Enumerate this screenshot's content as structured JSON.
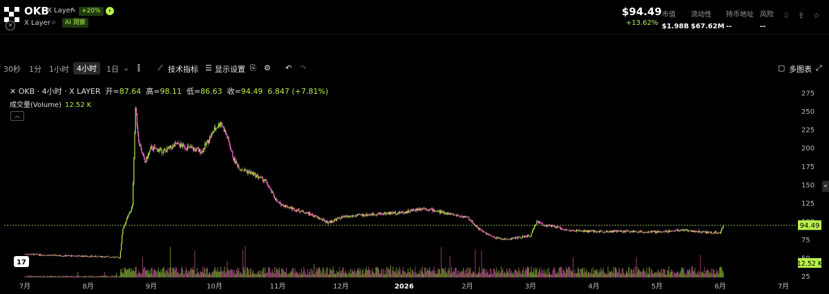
{
  "header": {
    "symbol": "OKB",
    "chain": "X Layer",
    "badge": "+20%",
    "ai_badge": "AI 洞察",
    "price": "$94.49",
    "change": "+13.62%",
    "stats": [
      {
        "label": "市值",
        "value": "$1.98B"
      },
      {
        "label": "流动性",
        "value": "$67.62M"
      },
      {
        "label": "持币地址",
        "value": "--"
      },
      {
        "label": "风险",
        "value": "--"
      }
    ]
  },
  "toolbar": {
    "intervals": [
      "30秒",
      "1分",
      "1小时",
      "4小时",
      "1日"
    ],
    "active_interval": "4小时",
    "indicators": "技术指标",
    "display_settings": "显示设置",
    "multi_chart": "多图表"
  },
  "legend": {
    "title": "OKB · 4小时 · X LAYER",
    "open_label": "开=",
    "open": "87.64",
    "high_label": "高=",
    "high": "98.11",
    "low_label": "低=",
    "low": "86.63",
    "close_label": "收=",
    "close": "94.49",
    "delta": "6.847 (+7.81%)",
    "volume_label": "成交量(Volume)",
    "volume": "12.52 K"
  },
  "colors": {
    "up": "#b8f04a",
    "down": "#ff6ec7",
    "accent": "#b8f04a"
  },
  "chart_data": {
    "type": "line",
    "x_labels": [
      "7月",
      "8月",
      "9月",
      "10月",
      "11月",
      "12月",
      "2026",
      "2月",
      "3月",
      "4月",
      "5月",
      "6月",
      "7月"
    ],
    "y_ticks": [
      25,
      50,
      75,
      100,
      125,
      150,
      175,
      200,
      225,
      250,
      275
    ],
    "ylim": [
      25,
      285
    ],
    "last_price_label": "94.49",
    "last_volume_label": "12.52 K",
    "series": [
      {
        "values": [
          [
            0,
            55
          ],
          [
            0.5,
            53
          ],
          [
            1,
            52
          ],
          [
            1.4,
            51
          ],
          [
            1.5,
            50
          ],
          [
            1.55,
            90
          ],
          [
            1.6,
            100
          ],
          [
            1.7,
            120
          ],
          [
            1.75,
            255
          ],
          [
            1.8,
            210
          ],
          [
            1.9,
            180
          ],
          [
            2,
            200
          ],
          [
            2.2,
            195
          ],
          [
            2.4,
            205
          ],
          [
            2.6,
            200
          ],
          [
            2.8,
            195
          ],
          [
            3,
            225
          ],
          [
            3.1,
            235
          ],
          [
            3.2,
            215
          ],
          [
            3.3,
            185
          ],
          [
            3.4,
            172
          ],
          [
            3.6,
            165
          ],
          [
            3.8,
            155
          ],
          [
            4,
            125
          ],
          [
            4.2,
            118
          ],
          [
            4.5,
            110
          ],
          [
            4.8,
            98
          ],
          [
            5,
            105
          ],
          [
            5.3,
            108
          ],
          [
            5.6,
            110
          ],
          [
            6,
            112
          ],
          [
            6.3,
            118
          ],
          [
            6.6,
            112
          ],
          [
            7,
            105
          ],
          [
            7.2,
            88
          ],
          [
            7.4,
            78
          ],
          [
            7.6,
            75
          ],
          [
            8,
            80
          ],
          [
            8.1,
            100
          ],
          [
            8.2,
            95
          ],
          [
            8.4,
            92
          ],
          [
            8.6,
            87
          ],
          [
            9,
            86
          ],
          [
            9.5,
            86
          ],
          [
            10,
            85
          ],
          [
            10.4,
            88
          ],
          [
            10.7,
            85
          ],
          [
            11,
            84
          ],
          [
            11.05,
            94.49
          ]
        ]
      }
    ]
  }
}
